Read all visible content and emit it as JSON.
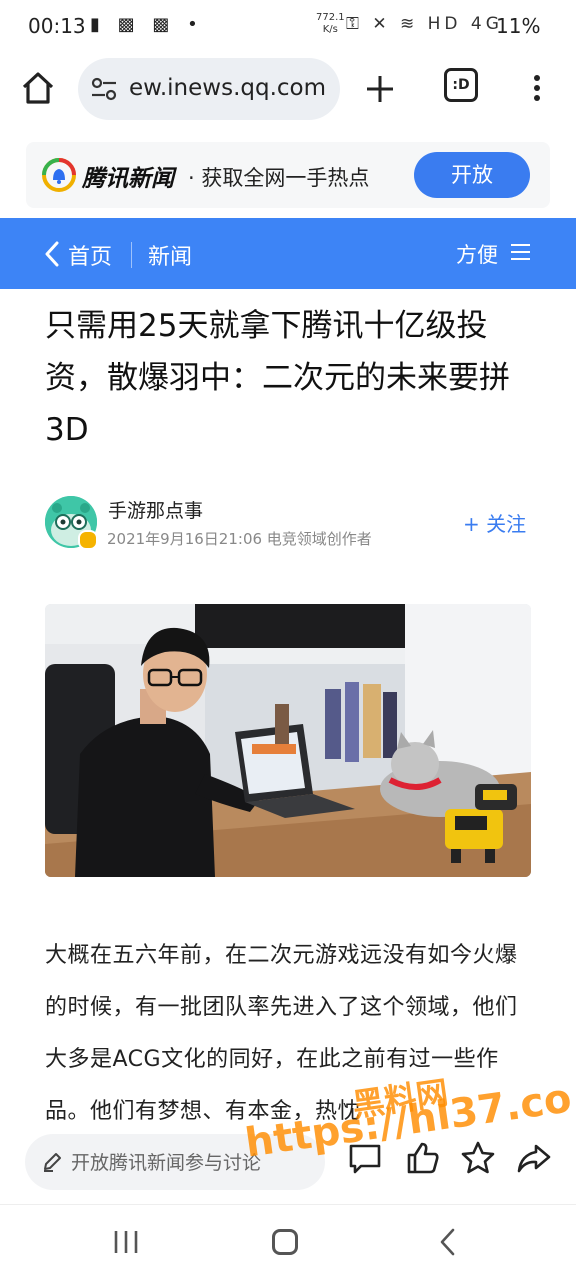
{
  "status_bar": {
    "time": "00:13",
    "left_icons": "▮ ▩ ▩ •",
    "net_speed_top": "772.1",
    "net_speed_bottom": "K/s",
    "right_icons": "⚿ ✕ ≋ HD 4G",
    "battery": "11%"
  },
  "browser": {
    "url": "ew.inews.qq.com",
    "tab_count_label": ":D"
  },
  "promo": {
    "brand": "腾讯新闻",
    "slogan": "· 获取全网一手热点",
    "open_button": "开放"
  },
  "nav": {
    "home": "首页",
    "news": "新闻",
    "easy": "方便"
  },
  "article": {
    "title": "只需用25天就拿下腾讯十亿级投资，散爆羽中：二次元的未来要拼3D",
    "author_name": "手游那点事",
    "author_meta": "2021年9月16日21:06  电竞领域创作者",
    "follow": "+ 关注",
    "body": "大概在五六年前，在二次元游戏远没有如今火爆的时候，有一批团队率先进入了这个领域，他们大多是ACG文化的同好，在此之前有过一些作品。他们有梦想、有本金，热忱"
  },
  "comment_bar": {
    "placeholder": "开放腾讯新闻参与讨论"
  },
  "watermark": {
    "line1": "黑料网",
    "line2": "https://hl37.co"
  },
  "colors": {
    "accent_blue": "#3d84f6",
    "button_blue": "#3a7cf0",
    "watermark_orange": "#ff8c00"
  }
}
